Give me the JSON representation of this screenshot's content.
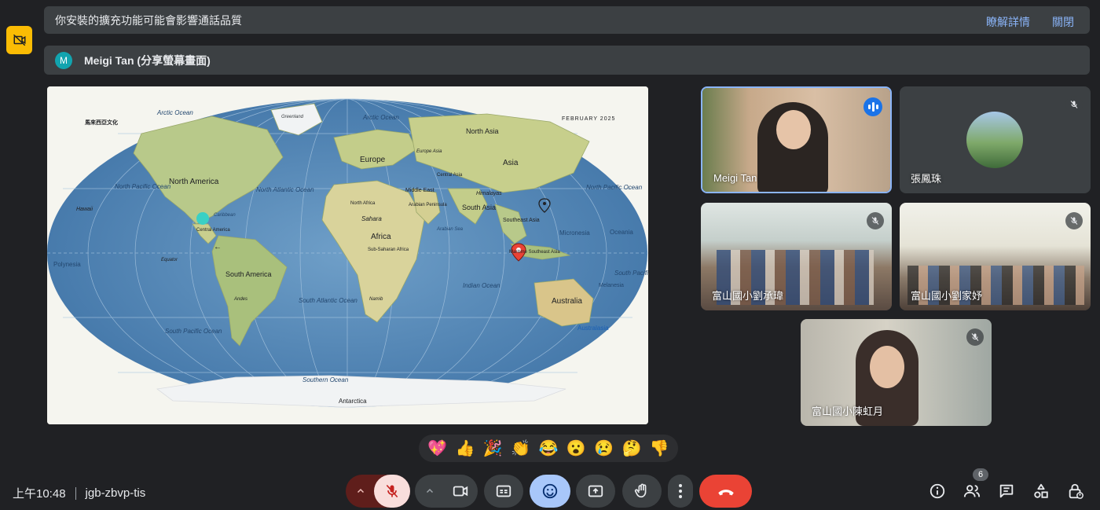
{
  "notice": {
    "message": "你安裝的擴充功能可能會影響通話品質",
    "learn_more": "瞭解詳情",
    "dismiss": "關閉"
  },
  "presenter": {
    "avatar_letter": "M",
    "label": "Meigi Tan (分享螢幕畫面)"
  },
  "shared_map": {
    "publisher": "馬來西亞文化",
    "date": "FEBRUARY 2025",
    "labels": {
      "arctic_ocean_left": "Arctic Ocean",
      "greenland": "Greenland",
      "arctic_ocean_mid": "Arctic Ocean",
      "north_asia": "North Asia",
      "europe_asia": "Europe Asia",
      "europe": "Europe",
      "asia": "Asia",
      "central_asia": "Central Asia",
      "north_america": "North America",
      "north_pacific_left": "North Pacific Ocean",
      "north_atlantic": "North Atlantic Ocean",
      "middle_east": "Middle East",
      "himalayas": "Himalayas",
      "north_pacific_right": "North Pacific Ocean",
      "hawaii": "Hawaii",
      "north_africa": "North Africa",
      "arabian_peninsula": "Arabian Peninsula",
      "south_asia": "South Asia",
      "caribbean": "Caribbean",
      "sahara": "Sahara",
      "southeast_asia": "Southeast Asia",
      "central_america": "Central America",
      "africa": "Africa",
      "arabian_sea": "Arabian Sea",
      "micronesia": "Micronesia",
      "oceania": "Oceania",
      "polynesia": "Polynesia",
      "equator": "Equator",
      "sub_saharan": "Sub-Saharan Africa",
      "maritime_se_asia": "Maritime Southeast Asia",
      "south_america": "South America",
      "south_pacific_right": "South Pacific Ocean",
      "melanesia": "Melanesia",
      "indian_ocean": "Indian Ocean",
      "south_atlantic": "South Atlantic Ocean",
      "andes": "Andes",
      "namib": "Namib",
      "australia": "Australia",
      "south_pacific_left": "South Pacific Ocean",
      "australasia": "Australasia",
      "southern_ocean": "Southern Ocean",
      "antarctica": "Antarctica"
    }
  },
  "participants": [
    {
      "name": "Meigi Tan",
      "state": "speaking"
    },
    {
      "name": "張鳳珠",
      "state": "muted"
    },
    {
      "name": "富山國小劉承瑋",
      "state": "muted"
    },
    {
      "name": "富山國小劉家妤",
      "state": "muted"
    },
    {
      "name": "富山國小陳虹月",
      "state": "muted"
    }
  ],
  "reactions": [
    "💖",
    "👍",
    "🎉",
    "👏",
    "😂",
    "😮",
    "😢",
    "🤔",
    "👎"
  ],
  "meeting": {
    "time": "上午10:48",
    "code": "jgb-zbvp-tis",
    "participant_count": "6"
  },
  "colors": {
    "background": "#202124",
    "surface": "#3c4043",
    "accent_blue": "#8ab4f8",
    "mic_off_red": "#ea4335",
    "end_call_red": "#ea4335",
    "reaction_active": "#8ab4f8",
    "warning_yellow": "#fbbc04"
  },
  "icons": {
    "warning": "video-off-icon",
    "speaking": "audio-level-icon",
    "mic_off": "mic-off-icon",
    "camera": "camera-icon",
    "captions": "captions-icon",
    "emoji": "emoji-icon",
    "present": "present-icon",
    "raise_hand": "hand-icon",
    "more": "more-vert-icon",
    "end_call": "end-call-icon",
    "info": "info-icon",
    "people": "people-icon",
    "chat": "chat-icon",
    "activities": "activities-icon",
    "host_controls": "lock-person-icon"
  }
}
